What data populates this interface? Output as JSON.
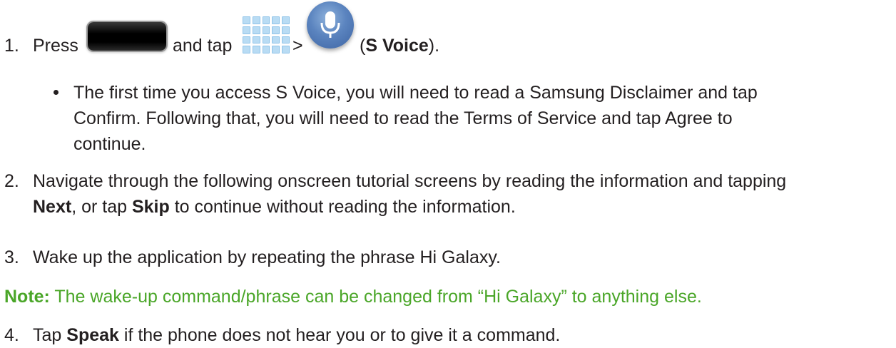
{
  "step1": {
    "number": "1.",
    "press": "Press",
    "and_tap": "and tap",
    "gt": ">",
    "paren_open": "(",
    "app_name": "S Voice",
    "paren_close": ")."
  },
  "icons": {
    "home_key": "home-key-icon",
    "apps": "apps-icon",
    "voice": "s-voice-icon"
  },
  "bullet": {
    "line1": "The first time you access S Voice, you will need to read a Samsung Disclaimer and tap",
    "line2": "Confirm. Following that, you will need to read the Terms of Service and tap Agree to",
    "line3": "continue."
  },
  "step2": {
    "number": "2.",
    "line1": "Navigate through the following onscreen tutorial screens by reading the information and tapping",
    "next": "Next",
    "or_tap": ", or tap ",
    "skip": "Skip",
    "rest": " to continue without reading the information."
  },
  "step3": {
    "number": "3.",
    "text": "Wake up the application by repeating the phrase Hi Galaxy."
  },
  "note": {
    "label": "Note:",
    "text": " The wake-up command/phrase can be changed from “Hi Galaxy” to anything else."
  },
  "step4": {
    "number": "4.",
    "tap": "Tap ",
    "speak": "Speak",
    "rest": " if the phone does not hear you or to give it a command."
  },
  "colors": {
    "text": "#231f20",
    "note": "#4aa628",
    "voice_icon": "#5b84bf",
    "apps_icon": "#b9dcf4"
  }
}
